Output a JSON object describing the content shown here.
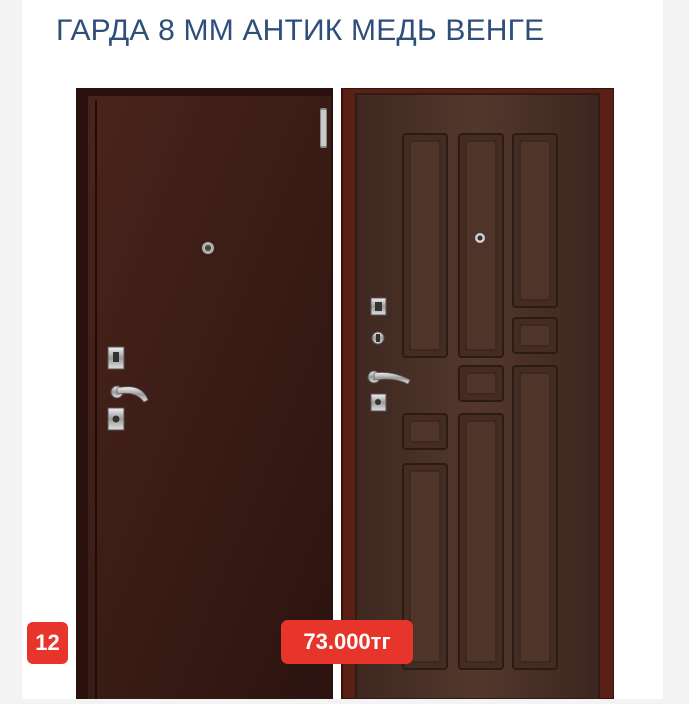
{
  "product": {
    "title": "ГАРДА 8 ММ АНТИК МЕДЬ ВЕНГЕ",
    "image_count": "12",
    "price": "73.000тг"
  },
  "colors": {
    "title": "#2f4f7a",
    "badge": "#e8352c",
    "metal_door": "#3a1c16",
    "wood_panel": "#4e342b",
    "frame": "#4a1a12"
  }
}
